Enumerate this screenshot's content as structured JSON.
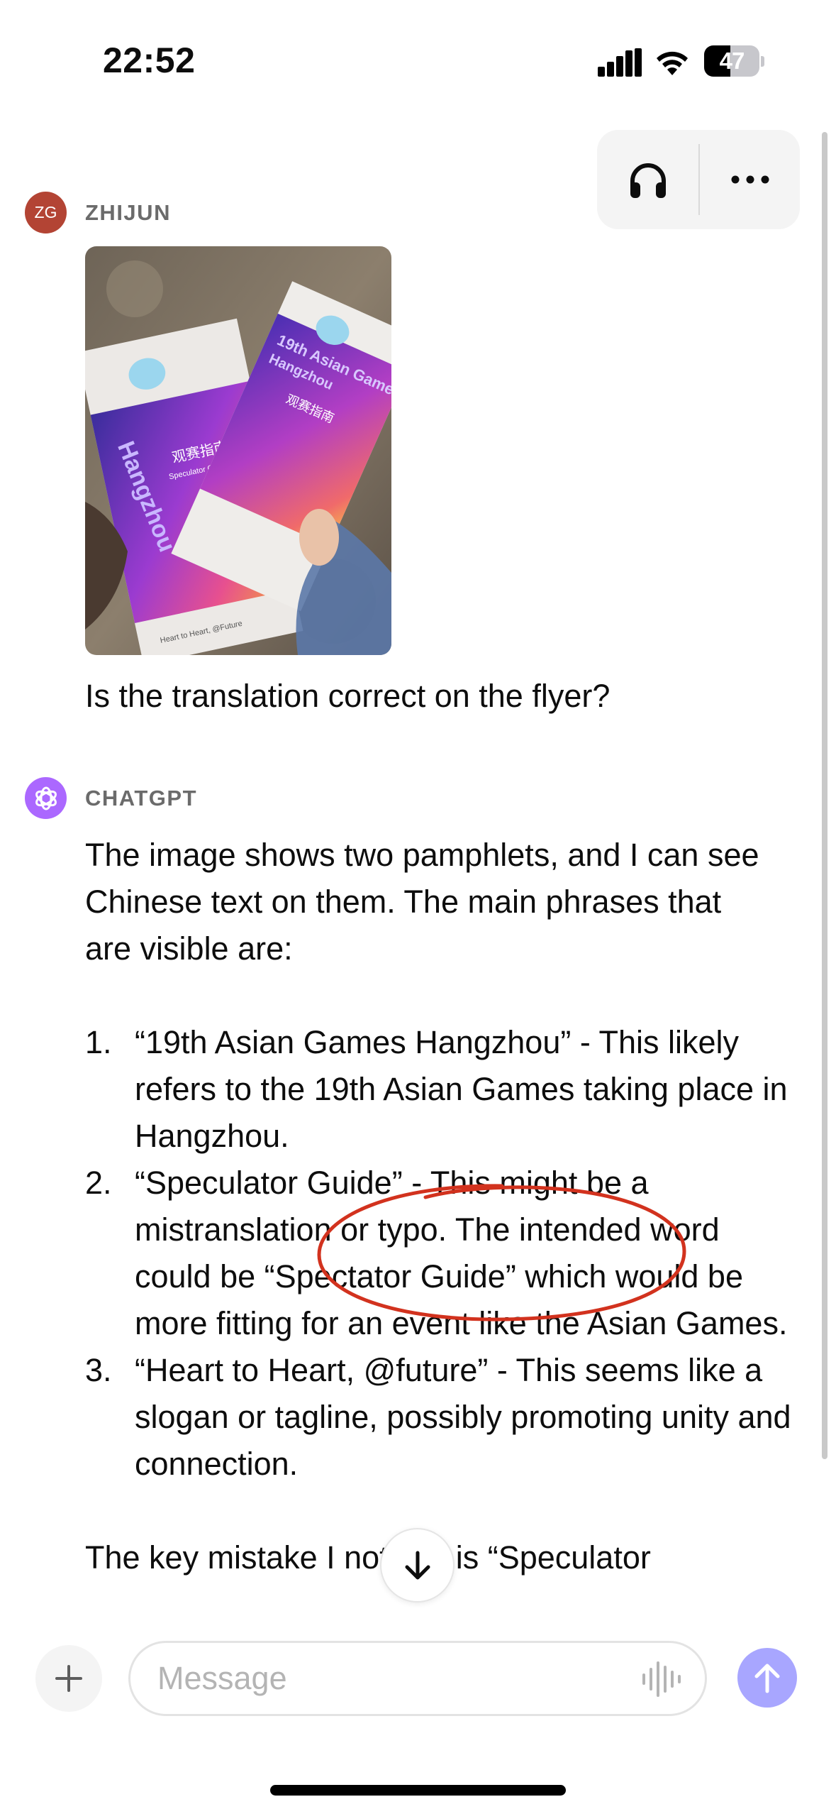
{
  "status_bar": {
    "time": "22:52",
    "battery_percent": "47",
    "battery_level": 0.47
  },
  "header": {
    "headphones_icon": "headphones-icon",
    "more_icon": "ellipsis-icon"
  },
  "user_message": {
    "avatar_initials": "ZG",
    "avatar_color": "#b34434",
    "sender": "ZHIJUN",
    "photo_visible_text": [
      "19th Asian Games Hangzhou",
      "观赛指南",
      "Speculator Guide",
      "Heart to Heart, @Future"
    ],
    "text": "Is the translation correct on the flyer?"
  },
  "assistant_message": {
    "avatar_color": "#ab68ff",
    "sender": "CHATGPT",
    "intro": "The image shows two pamphlets, and I can see Chinese text on them. The main phrases that are visible are:",
    "items": [
      {
        "num": "1.",
        "text": "“19th Asian Games Hangzhou” - This likely refers to the 19th Asian Games taking place in Hangzhou."
      },
      {
        "num": "2.",
        "text": "“Speculator Guide” - This might be a mistranslation or typo. The intended word could be “Spectator Guide” which would be more fitting for an event like the Asian Games."
      },
      {
        "num": "3.",
        "text": "“Heart to Heart, @future” - This seems like a slogan or tagline, possibly promoting unity and connection."
      }
    ],
    "trailing": "The key mistake I noticed is “Speculator"
  },
  "annotation": {
    "color": "#d2321e"
  },
  "composer": {
    "placeholder": "Message",
    "plus_icon": "plus-icon",
    "voice_icon": "voice-waveform-icon",
    "send_icon": "arrow-up-icon",
    "send_color": "#a8a6ff"
  },
  "scroll_down_icon": "arrow-down-icon"
}
